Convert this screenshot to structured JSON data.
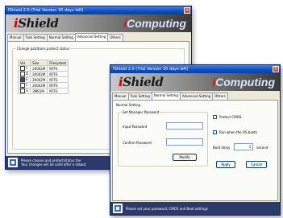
{
  "back_window": {
    "title": "fShield 2.0 (Trial Version 30 days left)",
    "logo_left": "Shield",
    "logo_right": "Computing",
    "tabs": [
      "Manual",
      "Task Setting",
      "Normal Setting",
      "Advanced Setting",
      "Others"
    ],
    "active_tab": "Advanced Setting",
    "group_title": "Change partitions protect status",
    "table_headers": [
      "Vol.",
      "Size",
      "Filesystem"
    ],
    "rows": [
      {
        "vol": "C",
        "size": "20002M",
        "fs": "NTFS",
        "checked": false
      },
      {
        "vol": "D",
        "size": "20002M",
        "fs": "NTFS",
        "checked": false
      },
      {
        "vol": "E",
        "size": "20002M",
        "fs": "NTFS",
        "checked": true
      },
      {
        "vol": "F",
        "size": "20002M",
        "fs": "NTFS",
        "checked": false
      },
      {
        "vol": "G",
        "size": "3MB1M",
        "fs": "NTFS",
        "checked": false
      }
    ],
    "status_line1": "Please choose and protect/status the",
    "status_line2": "Your changes will be valid after a reboot"
  },
  "front_window": {
    "title": "fShield 2.0 (Trial Version 30 days left)",
    "logo_left": "Shield",
    "logo_right": "Computing",
    "tabs": [
      "Manual",
      "Task Setting",
      "Normal Setting",
      "Advanced Setting",
      "Others"
    ],
    "active_tab": "Normal Setting",
    "section_label": "Normal Setting",
    "password_group_title": "Set Manager Password",
    "input_password_label": "Input Password",
    "confirm_password_label": "Confirm Password",
    "modify_button": "Modify",
    "protect_cmos_label": "Protect CMOS",
    "run_when_os_boots_label": "Run when the OS boots",
    "boot_delay_label": "Boot delay",
    "boot_delay_value": "3",
    "boot_delay_unit": "second",
    "apply_button": "Apply",
    "cancel_button": "Cancel",
    "status_text": "Please set your password, CMOS and Boot settings"
  },
  "colors": {
    "titlebar": "#0a4fc4",
    "window_bg": "#ece9d8",
    "brand_red": "#d10000",
    "status_bg": "#2b3a6b"
  }
}
